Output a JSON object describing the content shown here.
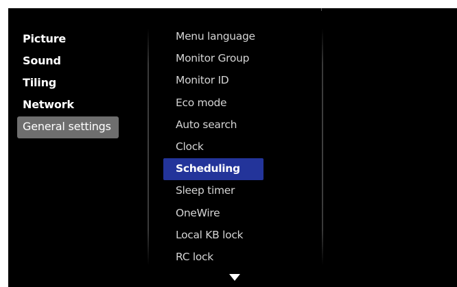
{
  "categories": [
    {
      "label": "Picture",
      "selected": false
    },
    {
      "label": "Sound",
      "selected": false
    },
    {
      "label": "Tiling",
      "selected": false
    },
    {
      "label": "Network",
      "selected": false
    },
    {
      "label": "General settings",
      "selected": true
    }
  ],
  "settings": [
    {
      "label": "Menu language",
      "selected": false
    },
    {
      "label": "Monitor Group",
      "selected": false
    },
    {
      "label": "Monitor ID",
      "selected": false
    },
    {
      "label": "Eco mode",
      "selected": false
    },
    {
      "label": "Auto search",
      "selected": false
    },
    {
      "label": "Clock",
      "selected": false
    },
    {
      "label": "Scheduling",
      "selected": true
    },
    {
      "label": "Sleep timer",
      "selected": false
    },
    {
      "label": "OneWire",
      "selected": false
    },
    {
      "label": "Local KB lock",
      "selected": false
    },
    {
      "label": "RC lock",
      "selected": false
    }
  ],
  "colors": {
    "background": "#000000",
    "category_highlight": "#6e6e6e",
    "setting_highlight": "#23349a",
    "text": "#ffffff"
  },
  "icons": {
    "scroll_down": "down-triangle-icon"
  }
}
